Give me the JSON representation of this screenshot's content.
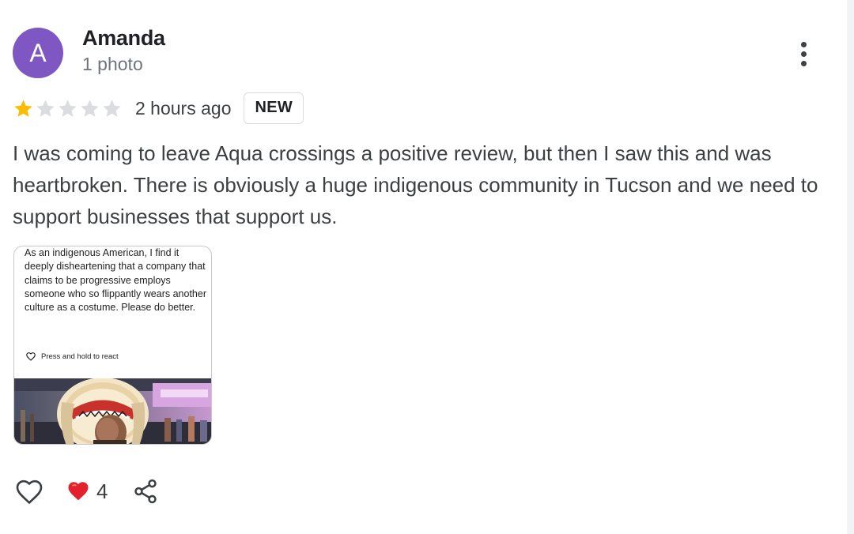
{
  "review": {
    "author": {
      "avatar_letter": "A",
      "avatar_color": "#7e57c2",
      "name": "Amanda",
      "meta": "1 photo"
    },
    "rating": {
      "value": 1,
      "max": 5,
      "filled_color": "#fbbc04",
      "empty_color": "#dadce0"
    },
    "time_ago": "2 hours ago",
    "badge": "NEW",
    "text": "I was coming to leave Aqua crossings a positive review, but then I saw this and was heartbroken. There is obviously a huge indigenous community in Tucson and we need to support businesses that support us.",
    "photo": {
      "caption_text": "As an indigenous American, I find it deeply disheartening that a company that claims to be progressive employs someone who so flippantly wears another culture as a costume. Please do better.",
      "react_prompt": "Press and hold to react",
      "react_icon": "heart-outline-icon"
    },
    "actions": {
      "like_icon": "heart-outline-icon",
      "reaction_icon": "red-heart-icon",
      "reaction_count": "4",
      "share_icon": "share-icon"
    },
    "more_icon": "more-vert-icon"
  }
}
